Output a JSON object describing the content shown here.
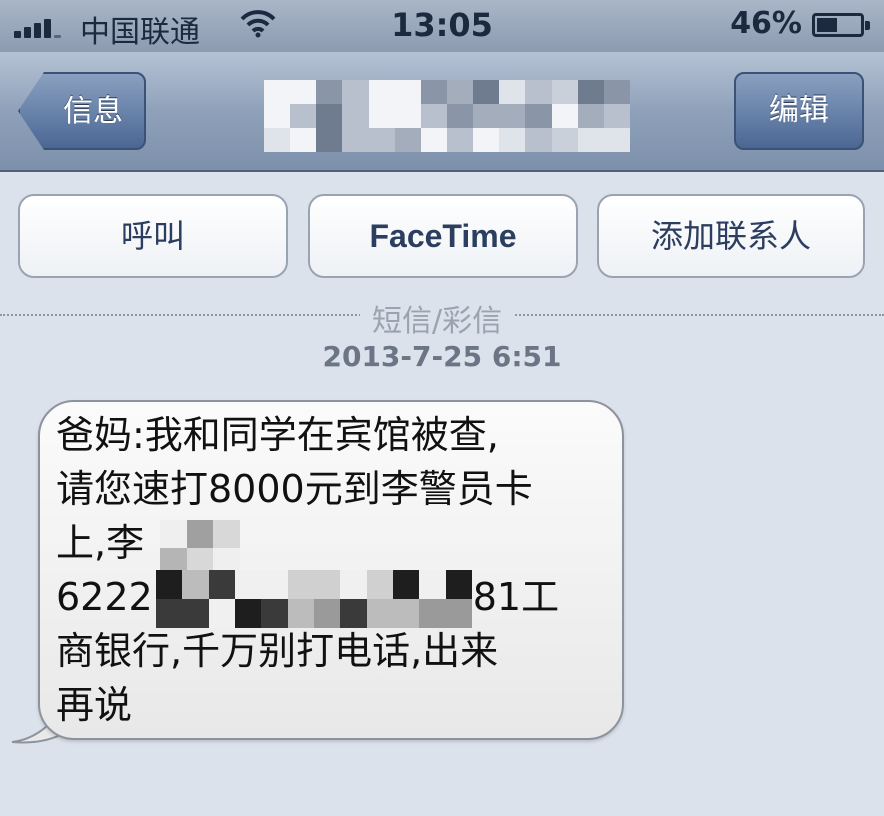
{
  "status_bar": {
    "carrier": "中国联通",
    "time": "13:05",
    "battery_percent_text": "46%",
    "battery_level": 0.46
  },
  "nav": {
    "back_label": "信息",
    "edit_label": "编辑"
  },
  "actions": {
    "call_label": "呼叫",
    "facetime_label": "FaceTime",
    "add_contact_label": "添加联系人"
  },
  "thread": {
    "message_type": "短信/彩信",
    "timestamp": "2013-7-25 6:51"
  },
  "message": {
    "line1": "爸妈:我和同学在宾馆被查,",
    "line2": "请您速打8000元到李警员卡",
    "line3": "上,李",
    "line4_start": "6222",
    "line4_end": "81工",
    "line5": "商银行,千万别打电话,出来",
    "line6": "再说"
  },
  "colors": {
    "nav_button": "#4a6794",
    "background": "#dbe2ec",
    "bubble": "#f4f4f4"
  }
}
